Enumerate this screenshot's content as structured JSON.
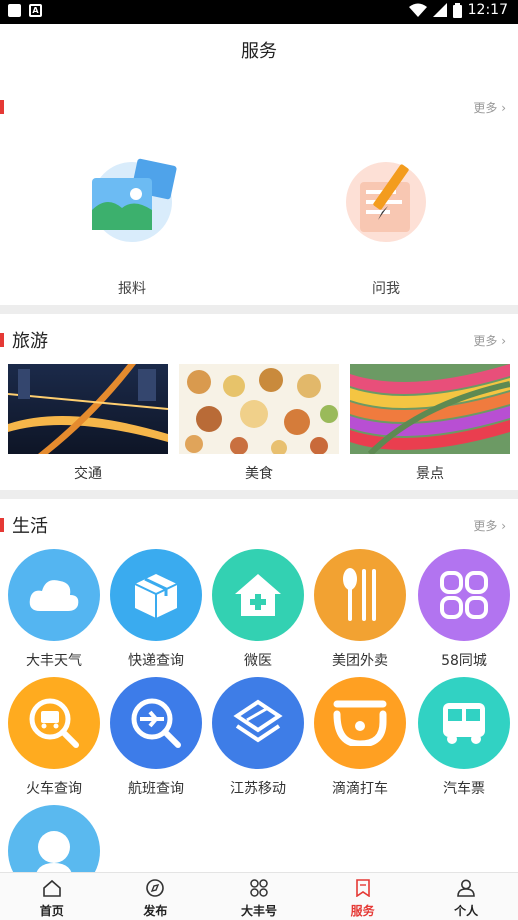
{
  "status_bar": {
    "time": "12:17"
  },
  "header": {
    "title": "服务"
  },
  "sections": {
    "top": {
      "more": "更多"
    },
    "travel": {
      "title": "旅游",
      "more": "更多"
    },
    "life": {
      "title": "生活",
      "more": "更多"
    }
  },
  "top_tiles": [
    {
      "label": "报料",
      "icon": "photo-icon"
    },
    {
      "label": "问我",
      "icon": "note-pencil-icon"
    }
  ],
  "travel_items": [
    {
      "label": "交通"
    },
    {
      "label": "美食"
    },
    {
      "label": "景点"
    }
  ],
  "life_items": [
    {
      "label": "大丰天气",
      "icon": "cloud-icon",
      "color": "#4fb3f0"
    },
    {
      "label": "快递查询",
      "icon": "box-icon",
      "color": "#38a9ef"
    },
    {
      "label": "微医",
      "icon": "house-plus-icon",
      "color": "#2fd0b0"
    },
    {
      "label": "美团外卖",
      "icon": "spoon-fork-icon",
      "color": "#f0a030"
    },
    {
      "label": "58同城",
      "icon": "grid-icon",
      "color": "#b173f0"
    },
    {
      "label": "火车查询",
      "icon": "train-search-icon",
      "color": "#ffa91e"
    },
    {
      "label": "航班查询",
      "icon": "plane-search-icon",
      "color": "#3b7bea"
    },
    {
      "label": "江苏移动",
      "icon": "mobile-logo-icon",
      "color": "#3c7be6"
    },
    {
      "label": "滴滴打车",
      "icon": "didi-icon",
      "color": "#ff9f20"
    },
    {
      "label": "汽车票",
      "icon": "bus-icon",
      "color": "#2fd1c0"
    },
    {
      "label": "",
      "icon": "person-icon",
      "color": "#58b8ee"
    }
  ],
  "tabs": [
    {
      "label": "首页",
      "icon": "home-icon",
      "active": false
    },
    {
      "label": "发布",
      "icon": "compass-icon",
      "active": false
    },
    {
      "label": "大丰号",
      "icon": "four-circles-icon",
      "active": false
    },
    {
      "label": "服务",
      "icon": "bookmark-icon",
      "active": true
    },
    {
      "label": "个人",
      "icon": "user-icon",
      "active": false
    }
  ]
}
